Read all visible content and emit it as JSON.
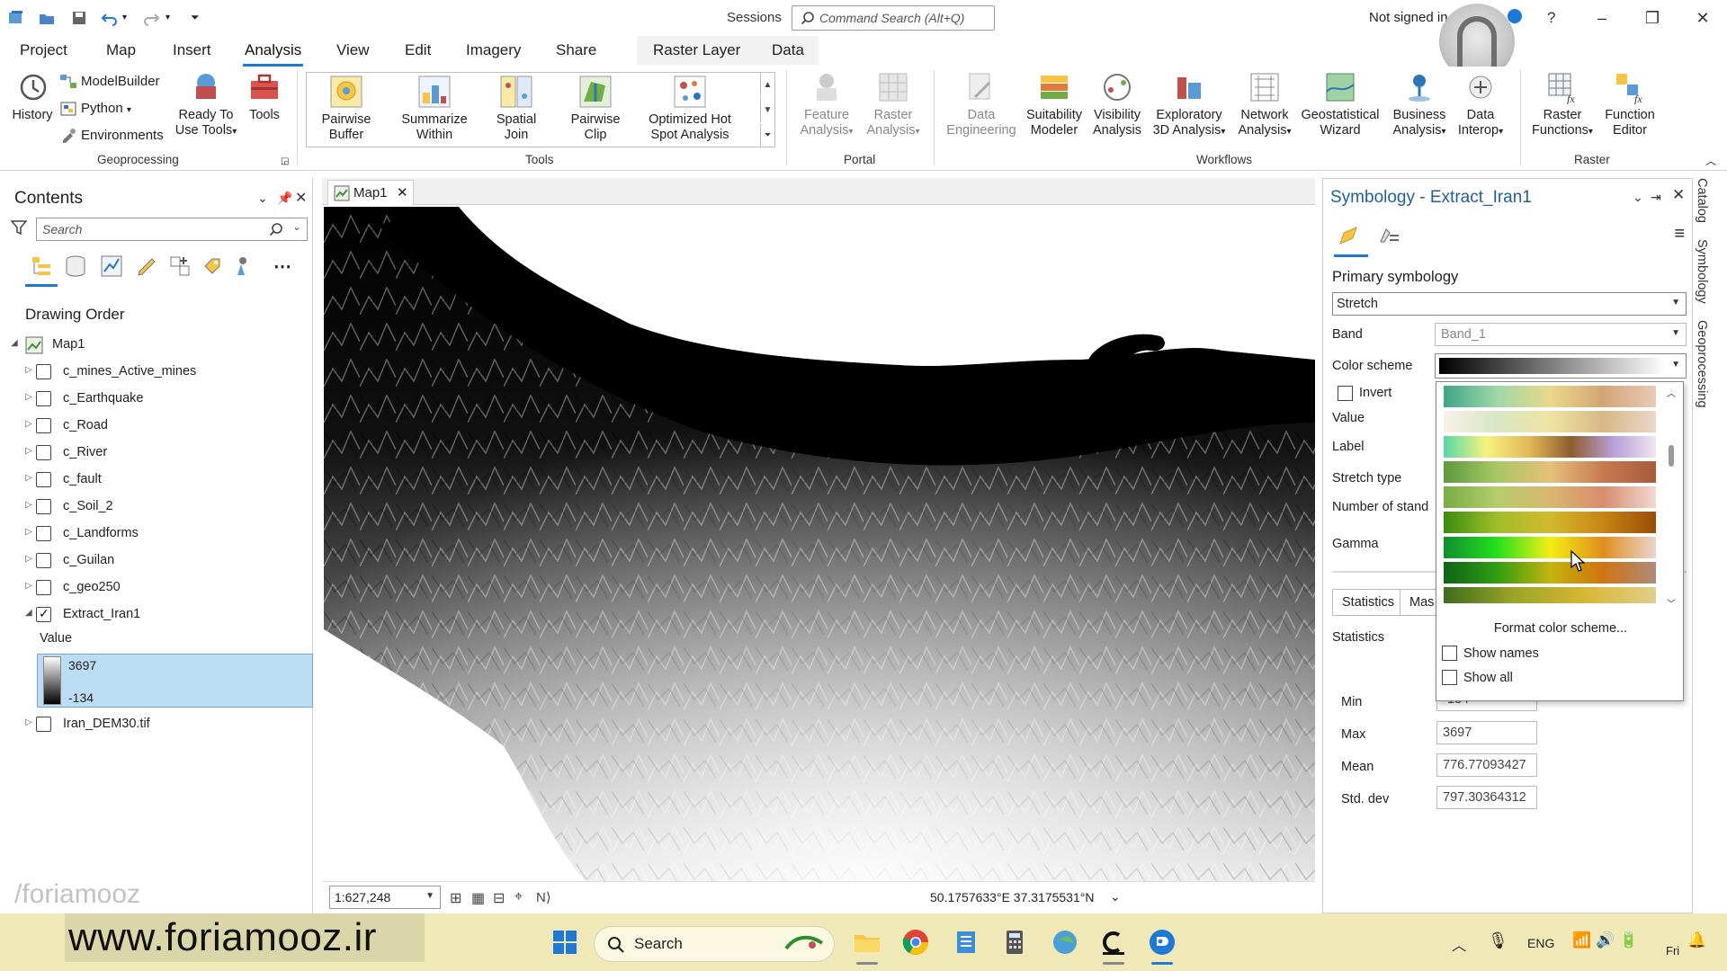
{
  "titlebar": {
    "sessions": "Sessions",
    "command_search_placeholder": "Command Search (Alt+Q)",
    "signin": "Not signed in",
    "help": "?"
  },
  "menu_tabs": [
    "Project",
    "Map",
    "Insert",
    "Analysis",
    "View",
    "Edit",
    "Imagery",
    "Share",
    "Raster Layer",
    "Data"
  ],
  "active_tab": "Analysis",
  "ribbon": {
    "history": "History",
    "modelbuilder": "ModelBuilder",
    "python": "Python",
    "environments": "Environments",
    "ready_to_use_tools": [
      "Ready To",
      "Use Tools"
    ],
    "tools": "Tools",
    "group_geoprocessing": "Geoprocessing",
    "gallery": [
      [
        "Pairwise",
        "Buffer"
      ],
      [
        "Summarize",
        "Within"
      ],
      [
        "Spatial",
        "Join"
      ],
      [
        "Pairwise",
        "Clip"
      ],
      [
        "Optimized Hot",
        "Spot Analysis"
      ]
    ],
    "group_tools": "Tools",
    "feature_analysis": [
      "Feature",
      "Analysis"
    ],
    "raster_analysis": [
      "Raster",
      "Analysis"
    ],
    "group_portal": "Portal",
    "data_engineering": [
      "Data",
      "Engineering"
    ],
    "suitability_modeler": [
      "Suitability",
      "Modeler"
    ],
    "visibility_analysis": [
      "Visibility",
      "Analysis"
    ],
    "exploratory_3d": [
      "Exploratory",
      "3D Analysis"
    ],
    "network_analysis": [
      "Network",
      "Analysis"
    ],
    "geostatistical_wizard": [
      "Geostatistical",
      "Wizard"
    ],
    "business_analysis": [
      "Business",
      "Analysis"
    ],
    "data_interop": [
      "Data",
      "Interop"
    ],
    "group_workflows": "Workflows",
    "raster_functions": [
      "Raster",
      "Functions"
    ],
    "function_editor": [
      "Function",
      "Editor"
    ],
    "group_raster": "Raster"
  },
  "contents": {
    "title": "Contents",
    "search_placeholder": "Search",
    "drawing_order": "Drawing Order",
    "map_name": "Map1",
    "layers": [
      {
        "name": "c_mines_Active_mines",
        "checked": false
      },
      {
        "name": "c_Earthquake",
        "checked": false
      },
      {
        "name": "c_Road",
        "checked": false
      },
      {
        "name": "c_River",
        "checked": false
      },
      {
        "name": "c_fault",
        "checked": false
      },
      {
        "name": "c_Soil_2",
        "checked": false
      },
      {
        "name": "c_Landforms",
        "checked": false
      },
      {
        "name": "c_Guilan",
        "checked": false
      },
      {
        "name": "c_geo250",
        "checked": false
      },
      {
        "name": "Extract_Iran1",
        "checked": true
      }
    ],
    "legend_heading": "Value",
    "legend_high": "3697",
    "legend_low": "-134",
    "last_layer": "Iran_DEM30.tif"
  },
  "map": {
    "tab": "Map1",
    "scale": "1:627,248",
    "coordinates": "50.1757633°E 37.3175531°N"
  },
  "symbology": {
    "title": "Symbology - Extract_Iran1",
    "primary_heading": "Primary symbology",
    "primary_value": "Stretch",
    "band_label": "Band",
    "band_value": "Band_1",
    "color_scheme_label": "Color scheme",
    "invert_label": "Invert",
    "value_label": "Value",
    "label_label": "Label",
    "stretch_type_label": "Stretch type",
    "number_of_std_label": "Number of stand",
    "gamma_label": "Gamma",
    "dropdown": {
      "format_scheme": "Format color scheme...",
      "show_names": "Show names",
      "show_all": "Show all"
    },
    "stat_tabs": [
      "Statistics",
      "Mas"
    ],
    "statistics_label": "Statistics",
    "min_label": "Min",
    "min_value": "-134",
    "max_label": "Max",
    "max_value": "3697",
    "mean_label": "Mean",
    "mean_value": "776.77093427",
    "std_label": "Std. dev",
    "std_value": "797.30364312"
  },
  "side_tabs": [
    "Catalog",
    "Symbology",
    "Geoprocessing"
  ],
  "watermark": {
    "main": "www.foriamooz.ir",
    "faint": "/foriamooz"
  },
  "taskbar": {
    "search": "Search",
    "lang": "ENG",
    "day": "Fri"
  },
  "colors": {
    "accent": "#1e78d6",
    "legend_selected": "#bcdcf3",
    "taskbar": "#efe9b8"
  }
}
